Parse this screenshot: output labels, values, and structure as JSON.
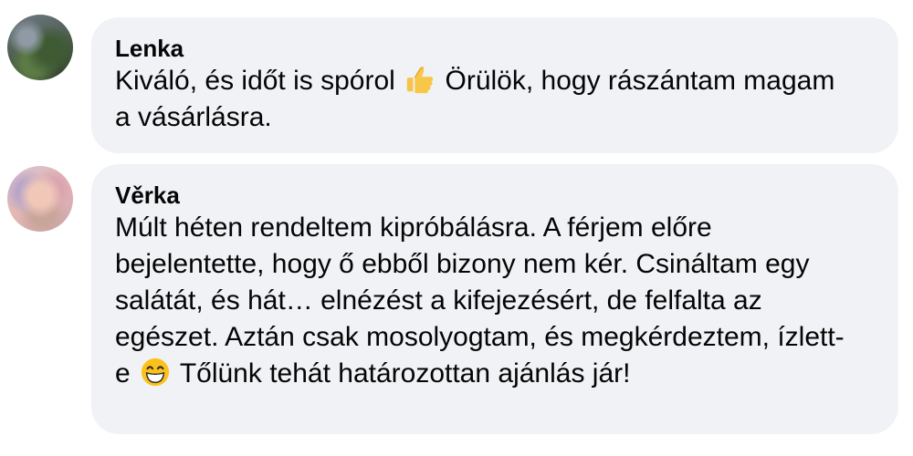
{
  "comments": [
    {
      "author": "Lenka",
      "text_before_emoji": "Kiváló, és időt is spórol ",
      "emoji": "thumbs-up-icon",
      "text_after_emoji": " Örülök, hogy rászántam magam a vásárlásra."
    },
    {
      "author": "Věrka",
      "text_before_emoji": "Múlt héten rendeltem kipróbálásra. A férjem előre bejelentette, hogy ő ebből bizony nem kér. Csináltam egy salátát, és hát… elnézést a kifejezésért, de felfalta az egészet. Aztán csak mosolyogtam, és megkérdeztem, ízlett-e ",
      "emoji": "grinning-face-icon",
      "text_after_emoji": " Tőlünk tehát határozottan ajánlás jár!"
    }
  ]
}
